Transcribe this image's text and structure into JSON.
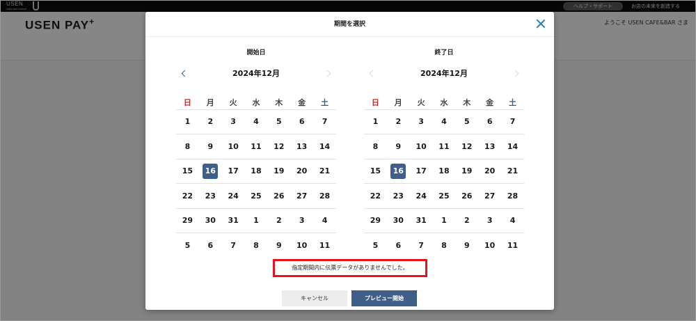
{
  "topbar": {
    "logo_text": "USEN",
    "logo_sub": "USEN-NEXT GROUP",
    "help_label": "ヘルプ・サポート",
    "slogan": "お店の未来を創造する"
  },
  "header": {
    "brand": "USEN PAY",
    "brand_plus": "+",
    "welcome": "ようこそ USEN CAFE&BAR さま"
  },
  "modal": {
    "title": "期間を選択",
    "weekdays": [
      "日",
      "月",
      "火",
      "水",
      "木",
      "金",
      "土"
    ],
    "start": {
      "label": "開始日",
      "month": "2024年12月",
      "rows": [
        [
          "1",
          "2",
          "3",
          "4",
          "5",
          "6",
          "7"
        ],
        [
          "8",
          "9",
          "10",
          "11",
          "12",
          "13",
          "14"
        ],
        [
          "15",
          "16",
          "17",
          "18",
          "19",
          "20",
          "21"
        ],
        [
          "22",
          "23",
          "24",
          "25",
          "26",
          "27",
          "28"
        ],
        [
          "29",
          "30",
          "31",
          "1",
          "2",
          "3",
          "4"
        ],
        [
          "5",
          "6",
          "7",
          "8",
          "9",
          "10",
          "11"
        ]
      ]
    },
    "end": {
      "label": "終了日",
      "month": "2024年12月",
      "rows": [
        [
          "1",
          "2",
          "3",
          "4",
          "5",
          "6",
          "7"
        ],
        [
          "8",
          "9",
          "10",
          "11",
          "12",
          "13",
          "14"
        ],
        [
          "15",
          "16",
          "17",
          "18",
          "19",
          "20",
          "21"
        ],
        [
          "22",
          "23",
          "24",
          "25",
          "26",
          "27",
          "28"
        ],
        [
          "29",
          "30",
          "31",
          "1",
          "2",
          "3",
          "4"
        ],
        [
          "5",
          "6",
          "7",
          "8",
          "9",
          "10",
          "11"
        ]
      ]
    },
    "selected_day": "16",
    "message": "指定期間内に伝票データがありませんでした。",
    "cancel_label": "キャンセル",
    "preview_label": "プレビュー開始"
  },
  "colors": {
    "accent": "#3f5f88",
    "sunday": "#b3312f",
    "highlight_border": "#e5141b",
    "close_icon": "#2f7fb6"
  }
}
